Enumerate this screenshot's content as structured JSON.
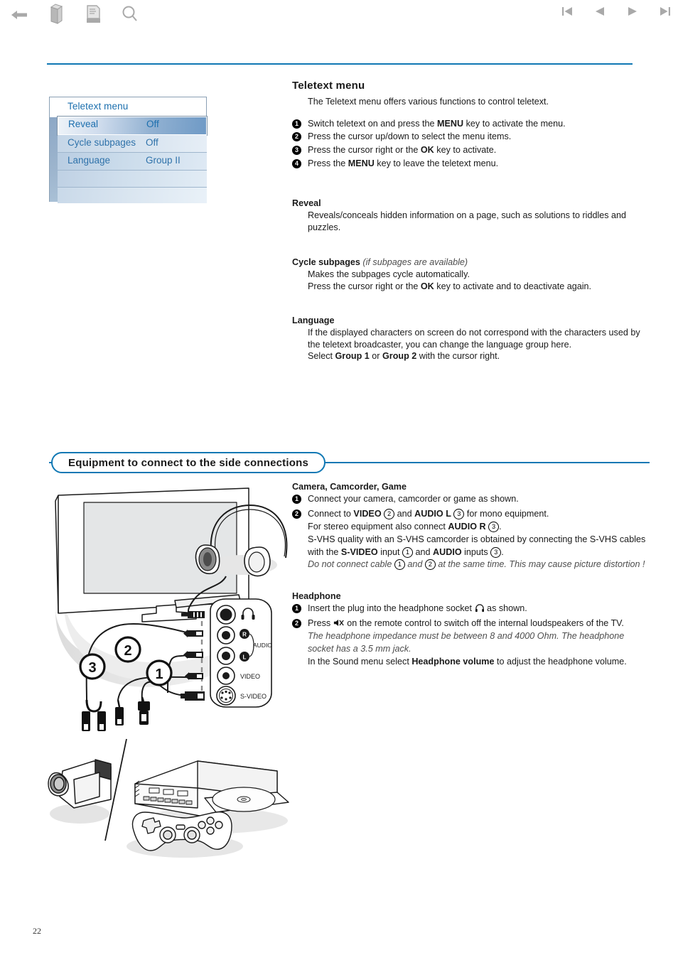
{
  "toolbar": {
    "left_icons": [
      {
        "name": "back-icon",
        "label": "Back"
      },
      {
        "name": "book-3d-icon",
        "label": "Contents"
      },
      {
        "name": "document-icon",
        "label": "Document"
      },
      {
        "name": "search-icon",
        "label": "Search"
      }
    ],
    "right_icons": [
      {
        "name": "first-page-icon",
        "label": "First page"
      },
      {
        "name": "previous-page-icon",
        "label": "Previous page"
      },
      {
        "name": "next-page-icon",
        "label": "Next page"
      },
      {
        "name": "last-page-icon",
        "label": "Last page"
      }
    ]
  },
  "accent_color": "#1078b4",
  "osd_menu": {
    "title": "Teletext menu",
    "rows": [
      {
        "label": "Reveal",
        "value": "Off",
        "selected": true
      },
      {
        "label": "Cycle subpages",
        "value": "Off",
        "selected": false
      },
      {
        "label": "Language",
        "value": "Group II",
        "selected": false
      }
    ]
  },
  "teletext": {
    "heading": "Teletext menu",
    "intro": "The Teletext menu offers various functions to control teletext.",
    "steps": [
      {
        "num": "1",
        "pre": "Switch teletext on and press the ",
        "bold": "MENU",
        "post": " key to activate the menu."
      },
      {
        "num": "2",
        "pre": "Press the cursor up/down to select the menu items.",
        "bold": "",
        "post": ""
      },
      {
        "num": "3",
        "pre": "Press the cursor right or the ",
        "bold": "OK",
        "post": " key to activate."
      },
      {
        "num": "4",
        "pre": "Press the ",
        "bold": "MENU",
        "post": " key to leave the teletext menu."
      }
    ],
    "reveal": {
      "heading": "Reveal",
      "body": "Reveals/conceals hidden information on a page, such as solutions to riddles and puzzles."
    },
    "cycle_subpages": {
      "heading": "Cycle subpages",
      "heading_note": "(if subpages are available)",
      "line1": "Makes the subpages cycle automatically.",
      "line2_pre": "Press the cursor right or the ",
      "line2_bold": "OK",
      "line2_post": " key to activate and to deactivate again."
    },
    "language": {
      "heading": "Language",
      "line1": "If the displayed characters on screen do not correspond with the characters used by the teletext broadcaster, you can change the language group here.",
      "line2_pre": "Select ",
      "line2_b1": "Group 1",
      "line2_mid": " or ",
      "line2_b2": "Group 2",
      "line2_post": " with the cursor right."
    }
  },
  "equipment": {
    "section_title": "Equipment to connect to the side connections",
    "camera": {
      "heading": "Camera, Camcorder, Game",
      "step1": "Connect your camera, camcorder or game as shown.",
      "step2_l1_a": "Connect to ",
      "step2_l1_b1": "VIDEO",
      "step2_l1_c1": "2",
      "step2_l1_d": " and ",
      "step2_l1_b2": "AUDIO L",
      "step2_l1_c2": "3",
      "step2_l1_e": " for mono equipment.",
      "step2_l2_a": "For stereo equipment also connect ",
      "step2_l2_b": "AUDIO R",
      "step2_l2_c": "3",
      "step2_l2_d": ".",
      "step2_l3": "S-VHS quality with an S-VHS camcorder is obtained by connecting the S-VHS cables with the ",
      "step2_l3_b1": "S-VIDEO",
      "step2_l3_mid": " input ",
      "step2_l3_c1": "1",
      "step2_l3_and": " and ",
      "step2_l3_b2": "AUDIO",
      "step2_l3_inputs": " inputs ",
      "step2_l3_c2": "3",
      "step2_l3_end": ".",
      "note_a": "Do not connect cable ",
      "note_c1": "1",
      "note_b": " and ",
      "note_c2": "2",
      "note_d": " at the same time. This may cause picture distortion !"
    },
    "headphone": {
      "heading": "Headphone",
      "step1_a": "Insert the plug into the headphone socket ",
      "step1_icon": "headphone-icon",
      "step1_b": " as shown.",
      "step2_a": "Press ",
      "step2_icon": "mute-icon",
      "step2_b": " on the remote control to switch off the internal loudspeakers of the TV.",
      "note": "The headphone impedance must be between 8 and 4000 Ohm. The headphone socket has a 3.5 mm jack.",
      "last_a": "In the Sound menu select ",
      "last_b": "Headphone volume",
      "last_c": " to adjust the headphone volume."
    }
  },
  "figure": {
    "connector_labels": [
      "AUDIO",
      "VIDEO",
      "S-VIDEO"
    ],
    "audio_r": "R",
    "audio_l": "L",
    "callouts": [
      "1",
      "2",
      "3"
    ]
  },
  "page_number": "22"
}
